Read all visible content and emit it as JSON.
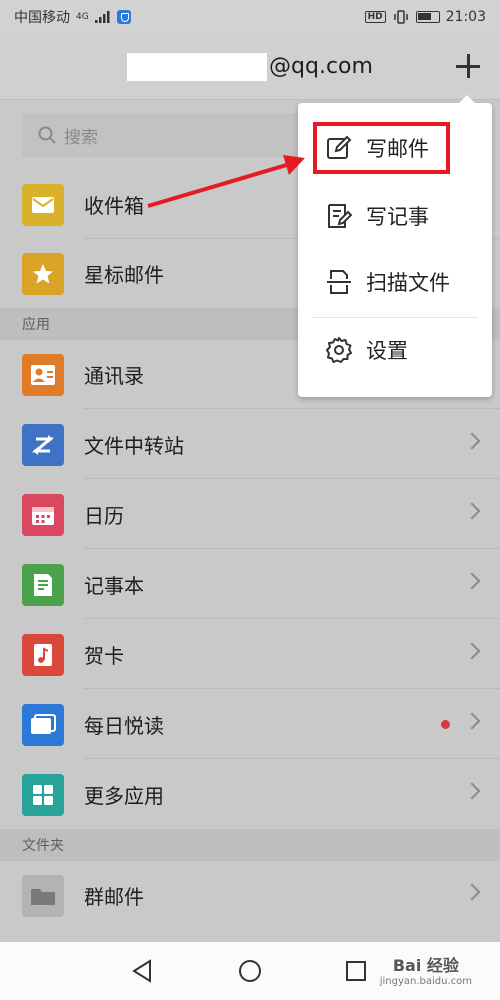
{
  "status_bar": {
    "carrier": "中国移动",
    "network": "4G",
    "time": "21:03",
    "hd": "HD",
    "battery_level": 0.7
  },
  "header": {
    "email_suffix": "@qq.com"
  },
  "search": {
    "placeholder": "搜索"
  },
  "rows": {
    "inbox": "收件箱",
    "starred": "星标邮件",
    "contacts": "通讯录",
    "transfer": "文件中转站",
    "calendar": "日历",
    "notepad": "记事本",
    "cards": "贺卡",
    "reading": "每日悦读",
    "more_apps": "更多应用",
    "group_mail": "群邮件"
  },
  "sections": {
    "apps": "应用",
    "folders": "文件夹"
  },
  "menu": {
    "compose": "写邮件",
    "note": "写记事",
    "scan": "扫描文件",
    "settings": "设置"
  },
  "watermark": {
    "brand": "Bai 经验",
    "url": "jingyan.baidu.com"
  },
  "colors": {
    "inbox": "#d9b12a",
    "starred": "#d9a426",
    "contacts": "#e07b28",
    "transfer": "#3e72c4",
    "calendar": "#d9485e",
    "notepad": "#4aa34a",
    "cards": "#d9483a",
    "reading": "#2b78d6",
    "more_apps": "#27a39a",
    "group_mail": "#9a9a9a",
    "highlight": "#e41b23"
  }
}
